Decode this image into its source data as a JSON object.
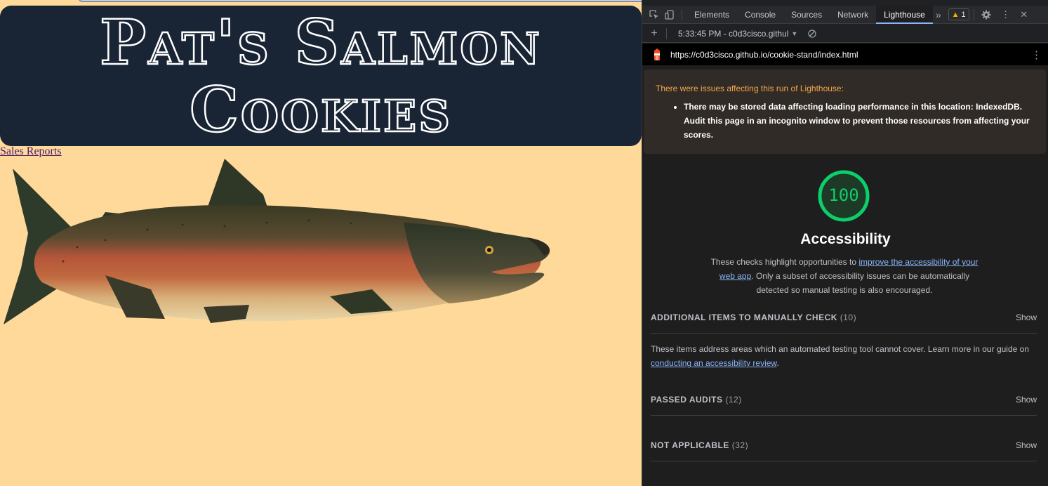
{
  "page": {
    "site_title": "Pat's Salmon Cookies",
    "nav_link": "Sales Reports",
    "colors": {
      "background": "#ffd999",
      "header": "#192435",
      "link": "#4a1a6e"
    }
  },
  "devtools": {
    "tabs": [
      {
        "label": "Elements"
      },
      {
        "label": "Console"
      },
      {
        "label": "Sources"
      },
      {
        "label": "Network"
      },
      {
        "label": "Lighthouse"
      }
    ],
    "active_tab": "Lighthouse",
    "warning_count": "1",
    "report_select": "5:33:45 PM - c0d3cisco.githul",
    "report_url": "https://c0d3cisco.github.io/cookie-stand/index.html",
    "warning": {
      "title": "There were issues affecting this run of Lighthouse:",
      "items": [
        "There may be stored data affecting loading performance in this location: IndexedDB. Audit this page in an incognito window to prevent those resources from affecting your scores."
      ]
    },
    "category": {
      "score": "100",
      "title": "Accessibility",
      "desc_pre": "These checks highlight opportunities to ",
      "desc_link": "improve the accessibility of your web app",
      "desc_post": ". Only a subset of accessibility issues can be automatically detected so manual testing is also encouraged."
    },
    "sections": [
      {
        "title": "Additional items to manually check",
        "count": "(10)",
        "action": "Show"
      },
      {
        "title": "Passed audits",
        "count": "(12)",
        "action": "Show"
      },
      {
        "title": "Not applicable",
        "count": "(32)",
        "action": "Show"
      }
    ],
    "manual_desc_pre": "These items address areas which an automated testing tool cannot cover. Learn more in our guide on ",
    "manual_desc_link": "conducting an accessibility review",
    "manual_desc_post": ".",
    "icons": {
      "inspect": "inspect-element-icon",
      "device": "device-toolbar-icon",
      "more_tabs": "more-tabs-icon",
      "warning": "warning-icon",
      "settings": "gear-icon",
      "menu": "kebab-menu-icon",
      "close": "close-icon",
      "add": "plus-icon",
      "clear": "clear-icon",
      "lighthouse": "lighthouse-icon"
    },
    "colors": {
      "pass": "#0cce6b",
      "link": "#8ab4f8",
      "warn": "#f4a74a"
    }
  }
}
